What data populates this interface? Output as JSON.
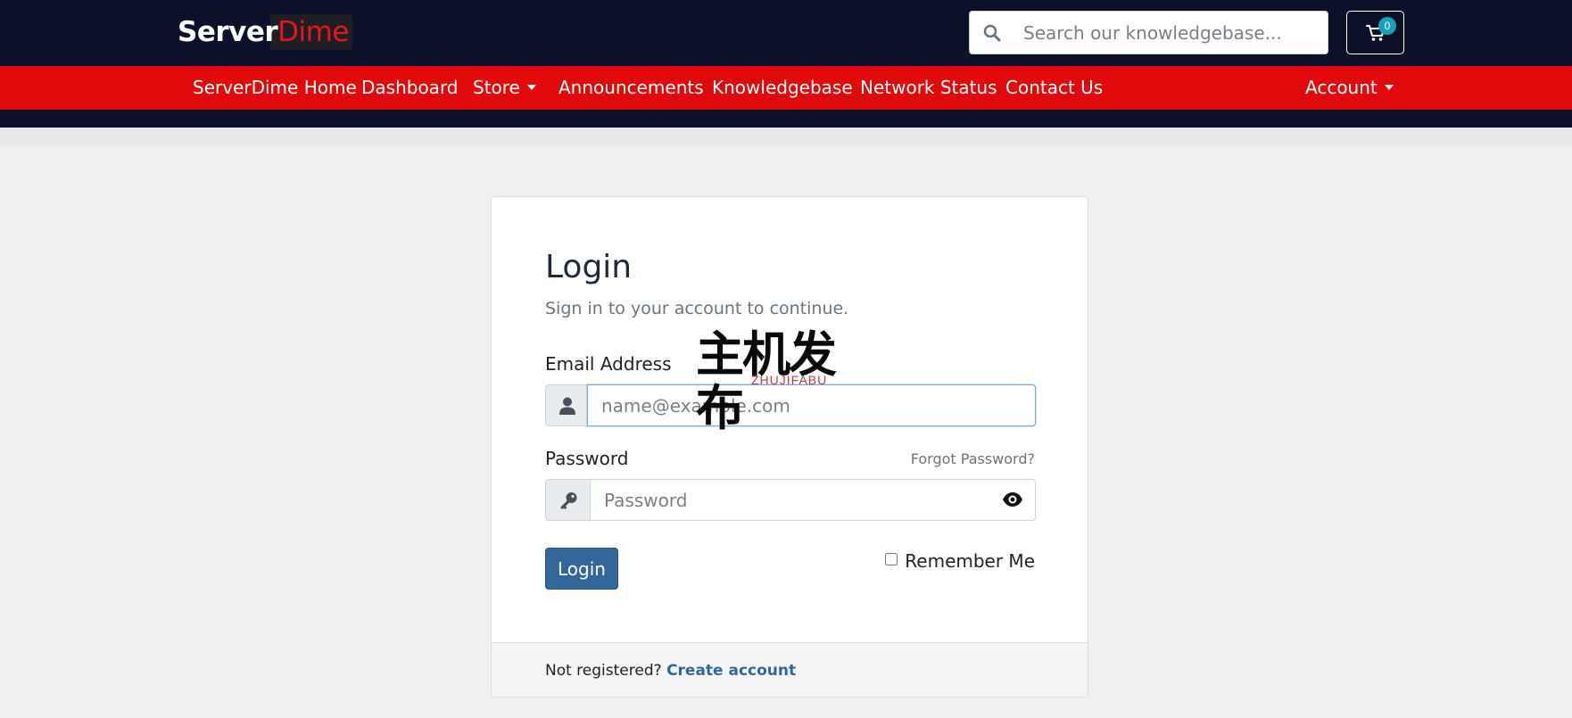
{
  "header": {
    "logo_part1": "Server",
    "logo_part2": "Dime",
    "search_placeholder": "Search our knowledgebase...",
    "search_icon": "search-icon",
    "cart_icon": "cart-icon",
    "cart_count": "0"
  },
  "nav": {
    "items": [
      {
        "label": "ServerDime Home"
      },
      {
        "label": "Dashboard"
      },
      {
        "label": "Store"
      },
      {
        "label": "Announcements"
      },
      {
        "label": "Knowledgebase"
      },
      {
        "label": "Network Status"
      },
      {
        "label": "Contact Us"
      }
    ],
    "account": "Account"
  },
  "login": {
    "title": "Login",
    "subtitle": "Sign in to your account to continue.",
    "email_label": "Email Address",
    "email_placeholder": "name@example.com",
    "password_label": "Password",
    "password_placeholder": "Password",
    "forgot": "Forgot Password?",
    "button": "Login",
    "remember": "Remember Me",
    "not_registered": "Not registered?",
    "create_account": "Create account"
  },
  "watermark": {
    "cn": "主机发布",
    "en": "ZHUJIFABU"
  },
  "colors": {
    "topbar": "#0c1129",
    "nav": "#e0090b",
    "button": "#336699",
    "logo_accent": "#e3181c"
  }
}
